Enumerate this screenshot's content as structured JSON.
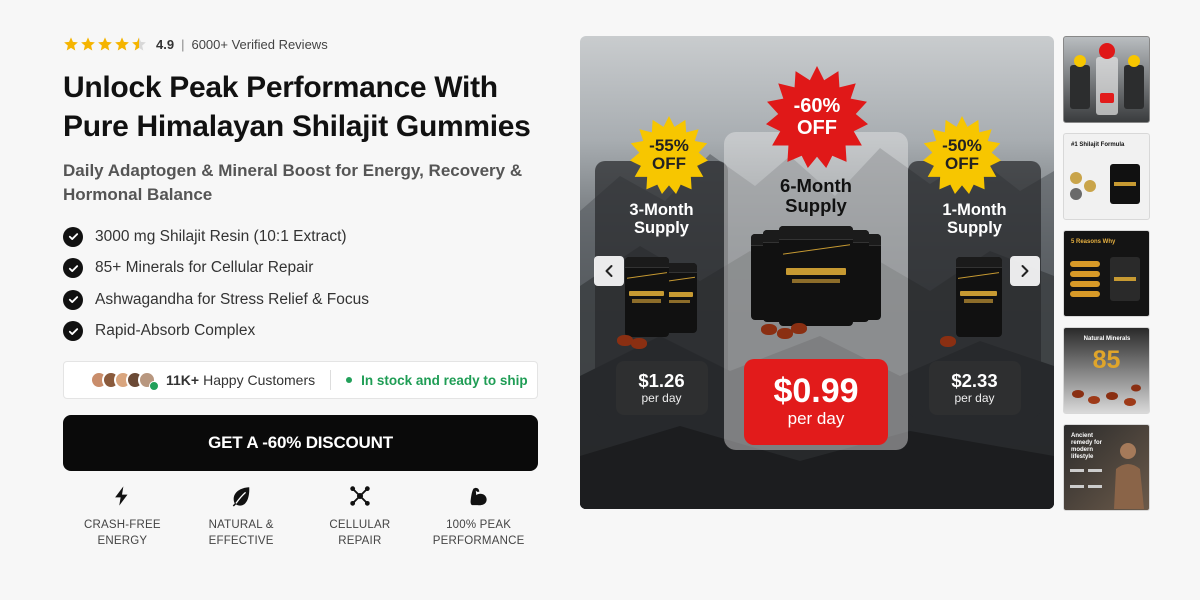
{
  "rating": {
    "score": "4.9",
    "separator": "|",
    "reviews": "6000+ Verified Reviews",
    "stars": 4.5
  },
  "hero": {
    "title": "Unlock Peak Performance With Pure Himalayan Shilajit Gummies",
    "subtitle": "Daily Adaptogen & Mineral Boost for Energy, Recovery & Hormonal Balance"
  },
  "benefits": [
    "3000 mg Shilajit Resin (10:1 Extract)",
    "85+ Minerals for Cellular Repair",
    "Ashwagandha for Stress Relief & Focus",
    "Rapid-Absorb Complex"
  ],
  "social_proof": {
    "count": "11K+",
    "label": "Happy Customers",
    "stock": "In stock and ready to ship"
  },
  "cta": {
    "label": "GET A -60% DISCOUNT"
  },
  "features": [
    {
      "icon": "lightning-icon",
      "label": "CRASH-FREE\nENERGY"
    },
    {
      "icon": "leaf-icon",
      "label": "NATURAL &\nEFFECTIVE"
    },
    {
      "icon": "molecule-icon",
      "label": "CELLULAR\nREPAIR"
    },
    {
      "icon": "muscle-icon",
      "label": "100% PEAK\nPERFORMANCE"
    }
  ],
  "gallery": {
    "offers": [
      {
        "title": "3-Month\nSupply",
        "badge_pct": "-55%",
        "badge_off": "OFF",
        "price": "$1.26",
        "per": "per day"
      },
      {
        "title": "6-Month\nSupply",
        "badge_pct": "-60%",
        "badge_off": "OFF",
        "price": "$0.99",
        "per": "per day"
      },
      {
        "title": "1-Month\nSupply",
        "badge_pct": "-50%",
        "badge_off": "OFF",
        "price": "$2.33",
        "per": "per day"
      }
    ],
    "jar_label": "himalia",
    "thumbnails": [
      {
        "title": ""
      },
      {
        "title": "#1 Shilajit Formula"
      },
      {
        "title": "5 Reasons Why"
      },
      {
        "title": "Natural Minerals",
        "big": "85"
      },
      {
        "title": "Ancient remedy for modern lifestyle"
      }
    ]
  },
  "colors": {
    "star": "#f5b400",
    "cta_bg": "#0a0a0a",
    "stock_green": "#1f9d55",
    "price_red": "#e21b1b",
    "badge_yellow": "#f7c600",
    "badge_red": "#e01818"
  }
}
